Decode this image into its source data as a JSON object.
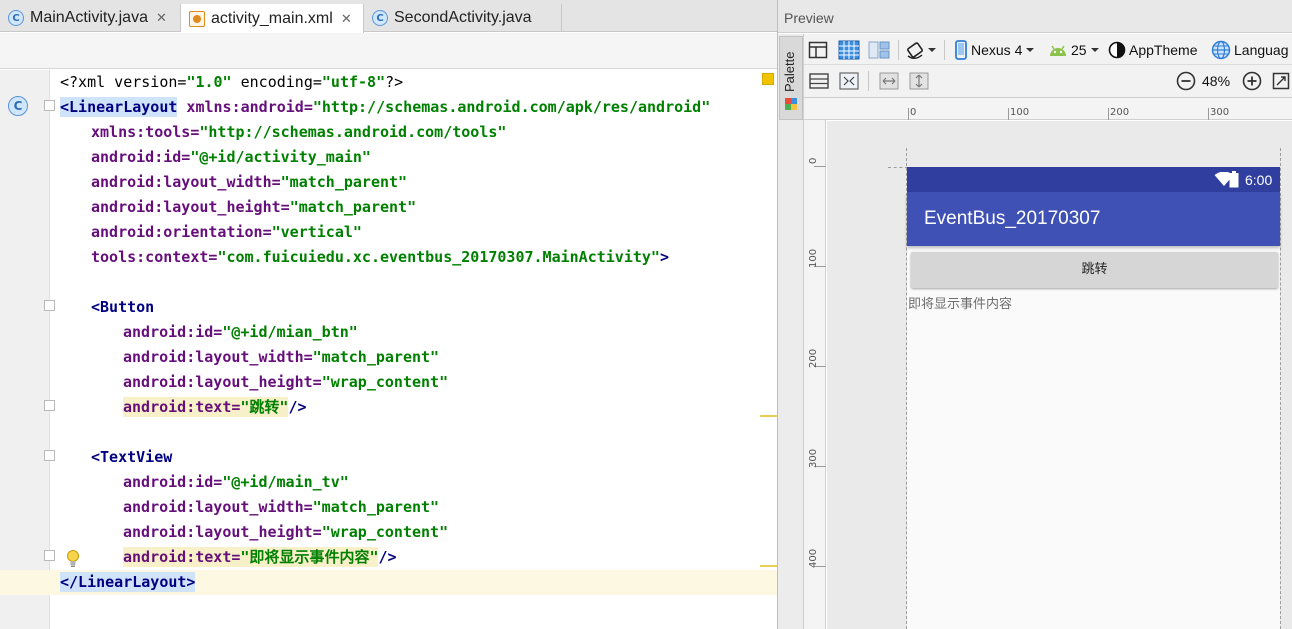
{
  "tabs": [
    {
      "label": "MainActivity.java",
      "icon": "java-class-icon",
      "active": false
    },
    {
      "label": "activity_main.xml",
      "icon": "xml-layout-icon",
      "active": true
    },
    {
      "label": "SecondActivity.java",
      "icon": "java-class-icon",
      "active": false
    }
  ],
  "close_glyph": "✕",
  "gutter": {
    "class_marker": "C"
  },
  "code": {
    "l1": {
      "a": "<?xml version=",
      "b": "\"1.0\"",
      "c": " encoding=",
      "d": "\"utf-8\"",
      "e": "?>"
    },
    "l2": {
      "tag": "<LinearLayout",
      "attr": " xmlns:android=",
      "val": "\"http://schemas.android.com/apk/res/android\""
    },
    "l3": {
      "attr": "xmlns:tools=",
      "val": "\"http://schemas.android.com/tools\""
    },
    "l4": {
      "attr": "android:id=",
      "val": "\"@+id/activity_main\""
    },
    "l5": {
      "attr": "android:layout_width=",
      "val": "\"match_parent\""
    },
    "l6": {
      "attr": "android:layout_height=",
      "val": "\"match_parent\""
    },
    "l7": {
      "attr": "android:orientation=",
      "val": "\"vertical\""
    },
    "l8": {
      "attr": "tools:context=",
      "val": "\"com.fuicuiedu.xc.eventbus_20170307.MainActivity\"",
      "end": ">"
    },
    "l10": {
      "tag": "<Button"
    },
    "l11": {
      "attr": "android:id=",
      "val": "\"@+id/mian_btn\""
    },
    "l12": {
      "attr": "android:layout_width=",
      "val": "\"match_parent\""
    },
    "l13": {
      "attr": "android:layout_height=",
      "val": "\"wrap_content\""
    },
    "l14": {
      "attr": "android:text=",
      "val": "\"跳转\"",
      "end": "/>"
    },
    "l16": {
      "tag": "<TextView"
    },
    "l17": {
      "attr": "android:id=",
      "val": "\"@+id/main_tv\""
    },
    "l18": {
      "attr": "android:layout_width=",
      "val": "\"match_parent\""
    },
    "l19": {
      "attr": "android:layout_height=",
      "val": "\"wrap_content\""
    },
    "l20": {
      "attr": "android:text=",
      "val": "\"即将显示事件内容\"",
      "end": "/>"
    },
    "l21": {
      "tag": "</LinearLayout>"
    }
  },
  "preview": {
    "title": "Preview",
    "palette_label": "Palette",
    "device": "Nexus 4",
    "api": "25",
    "theme": "AppTheme",
    "language": "Languag",
    "zoom": "48%",
    "ruler_h": [
      "0",
      "100",
      "200",
      "300"
    ],
    "ruler_v": [
      "0",
      "100",
      "200",
      "300",
      "400"
    ],
    "status_time": "6:00",
    "app_title": "EventBus_20170307",
    "button_text": "跳转",
    "textview_text": "即将显示事件内容"
  },
  "colors": {
    "status_bar": "#303f9f",
    "app_bar": "#3f51b5",
    "xml_tag": "#000080",
    "xml_attr": "#660e7a",
    "xml_value": "#008000"
  }
}
